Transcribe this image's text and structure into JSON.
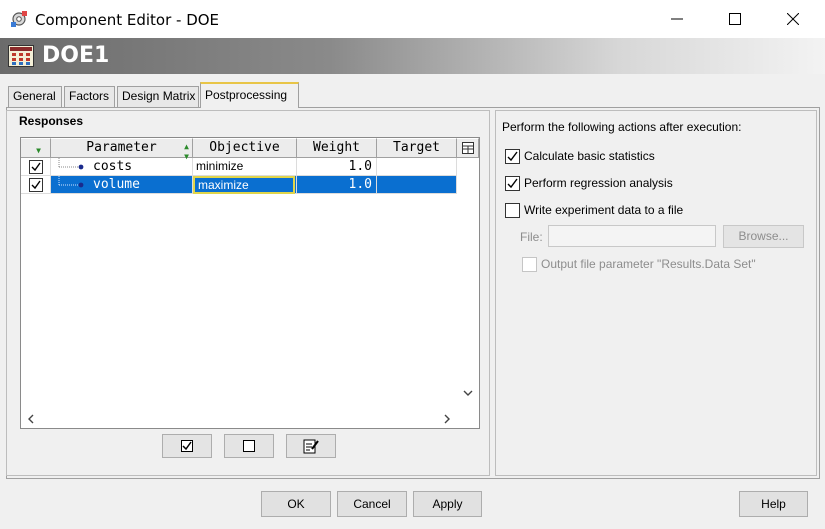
{
  "window": {
    "title": "Component Editor - DOE",
    "icon": "component-gear-icon",
    "controls": [
      "minimize-icon",
      "maximize-icon",
      "close-icon"
    ]
  },
  "header": {
    "icon": "doe-grid-icon",
    "title": "DOE1"
  },
  "tabs": [
    {
      "label": "General",
      "active": false
    },
    {
      "label": "Factors",
      "active": false
    },
    {
      "label": "Design Matrix",
      "active": false
    },
    {
      "label": "Postprocessing",
      "active": true
    }
  ],
  "responses": {
    "title": "Responses",
    "columns": [
      "Parameter",
      "Objective",
      "Weight",
      "Target"
    ],
    "column_menu_icon": "column-chooser-icon",
    "rows": [
      {
        "checked": true,
        "parameter": "costs",
        "objective": "minimize",
        "weight": "1.0",
        "target": "",
        "selected": false
      },
      {
        "checked": true,
        "parameter": "volume",
        "objective": "maximize",
        "weight": "1.0",
        "target": "",
        "selected": true
      }
    ],
    "buttons": [
      {
        "name": "check-all-icon"
      },
      {
        "name": "uncheck-all-icon"
      },
      {
        "name": "edit-notes-icon"
      }
    ]
  },
  "post_actions": {
    "heading": "Perform the following actions after execution:",
    "options": [
      {
        "label": "Calculate basic statistics",
        "checked": true,
        "enabled": true
      },
      {
        "label": "Perform regression analysis",
        "checked": true,
        "enabled": true
      },
      {
        "label": "Write experiment data to a file",
        "checked": false,
        "enabled": true
      }
    ],
    "file_label": "File:",
    "file_value": "",
    "browse_label": "Browse...",
    "output_param_label": "Output file parameter \"Results.Data Set\"",
    "output_param_checked": false
  },
  "footer": {
    "ok": "OK",
    "cancel": "Cancel",
    "apply": "Apply",
    "help": "Help"
  },
  "colors": {
    "selection": "#0a6fd0",
    "active_tab_accent": "#e8c547"
  }
}
